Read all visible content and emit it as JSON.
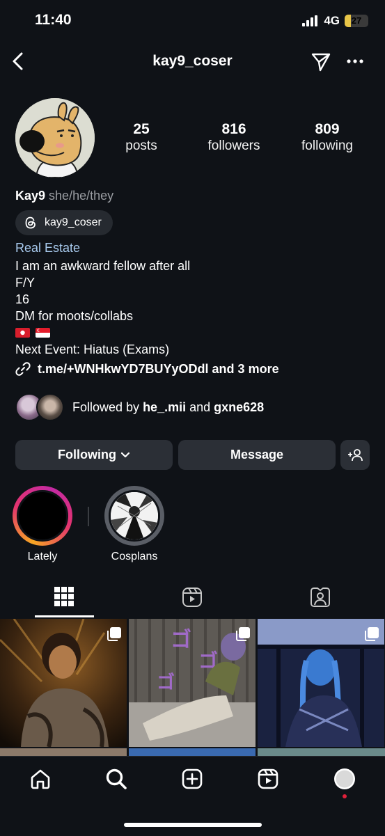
{
  "status": {
    "time": "11:40",
    "network": "4G",
    "battery": "27",
    "battery_level": 0.27
  },
  "header": {
    "username": "kay9_coser"
  },
  "profile": {
    "stats": [
      {
        "value": "25",
        "label": "posts"
      },
      {
        "value": "816",
        "label": "followers"
      },
      {
        "value": "809",
        "label": "following"
      }
    ],
    "name": "Kay9",
    "pronouns": "she/he/they",
    "threads_handle": "kay9_coser",
    "category": "Real Estate",
    "bio_lines": [
      "I am an awkward fellow after all",
      "F/Y",
      "16",
      "DM for moots/collabs"
    ],
    "next_event": "Next Event: Hiatus (Exams)",
    "link": "t.me/+WNHkwYD7BUYyODdl and 3 more",
    "followed_by": {
      "prefix": "Followed by ",
      "user1": "he_.mii",
      "conj": " and ",
      "user2": "gxne628"
    }
  },
  "actions": {
    "following_label": "Following",
    "message_label": "Message"
  },
  "highlights": [
    {
      "label": "Lately"
    },
    {
      "label": "Cosplans"
    }
  ],
  "tabs": [
    "grid-icon",
    "reels-icon",
    "tagged-icon"
  ],
  "colors": {
    "background": "#0f1217",
    "button": "#2b2f36",
    "category_link": "#a9cbef",
    "notification_dot": "#e0203a"
  }
}
